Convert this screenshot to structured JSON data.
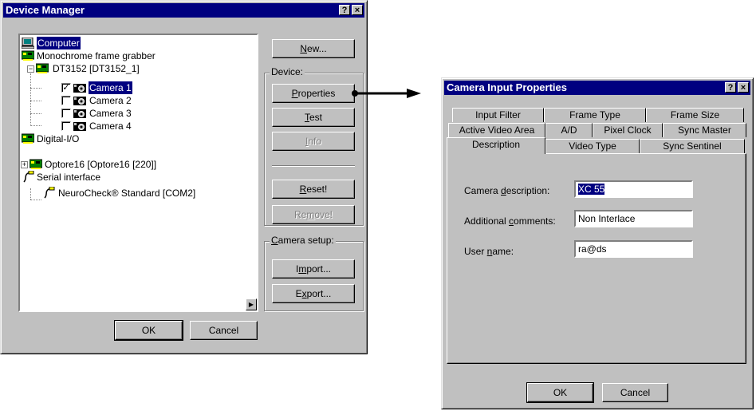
{
  "device_manager": {
    "title": "Device Manager",
    "help_glyph": "?",
    "close_glyph": "×",
    "tree": [
      {
        "label": "Computer",
        "icon": "computer-icon",
        "selected": true
      },
      {
        "label": "Monochrome frame grabber",
        "icon": "board-icon"
      },
      {
        "label": "DT3152 [DT3152_1]",
        "icon": "board-icon",
        "expander": "−"
      },
      {
        "label": "Camera 1",
        "icon": "camera-icon",
        "checked": true,
        "selected": true
      },
      {
        "label": "Camera 2",
        "icon": "camera-icon",
        "checked": false
      },
      {
        "label": "Camera 3",
        "icon": "camera-icon",
        "checked": false
      },
      {
        "label": "Camera 4",
        "icon": "camera-icon",
        "checked": false
      },
      {
        "label": "Digital-I/O",
        "icon": "board-icon"
      },
      {
        "label": "Optore16 [Optore16 [220]]",
        "icon": "board-icon",
        "expander": "+"
      },
      {
        "label": "Serial interface",
        "icon": "serial-icon"
      },
      {
        "label": "NeuroCheck® Standard [COM2]",
        "icon": "serial-icon"
      }
    ],
    "check_mark": "✓",
    "scroll_arrow": "▶",
    "buttons": {
      "new": {
        "pre": "",
        "key": "N",
        "post": "ew..."
      },
      "properties": {
        "pre": "",
        "key": "P",
        "post": "roperties"
      },
      "test": {
        "pre": "",
        "key": "T",
        "post": "est"
      },
      "info": {
        "pre": "",
        "key": "I",
        "post": "nfo"
      },
      "reset": {
        "pre": "",
        "key": "R",
        "post": "eset!"
      },
      "remove": {
        "pre": "Re",
        "key": "m",
        "post": "ove!"
      },
      "import": {
        "pre": "I",
        "key": "m",
        "post": "port..."
      },
      "export": {
        "pre": "E",
        "key": "x",
        "post": "port..."
      },
      "ok": "OK",
      "cancel": "Cancel"
    },
    "groups": {
      "device": "Device:",
      "camera_setup": {
        "key": "C",
        "rest": "amera setup:"
      }
    }
  },
  "camera_input": {
    "title": "Camera Input Properties",
    "help_glyph": "?",
    "close_glyph": "×",
    "tabs_row1": [
      "Input Filter",
      "Frame Type",
      "Frame Size"
    ],
    "tabs_row2": [
      "Active Video Area",
      "A/D",
      "Pixel Clock",
      "Sync Master"
    ],
    "tabs_row3": [
      "Description",
      "Video Type",
      "Sync Sentinel"
    ],
    "active_tab": "Description",
    "fields": {
      "camera_description": {
        "label_pre": "Camera ",
        "label_key": "d",
        "label_post": "escription:",
        "value": "XC 55"
      },
      "additional_comments": {
        "label_pre": "Additional ",
        "label_key": "c",
        "label_post": "omments:",
        "value": "Non Interlace"
      },
      "user_name": {
        "label_pre": "User ",
        "label_key": "n",
        "label_post": "ame:",
        "value": "ra@ds"
      }
    },
    "ok": "OK",
    "cancel": "Cancel"
  }
}
